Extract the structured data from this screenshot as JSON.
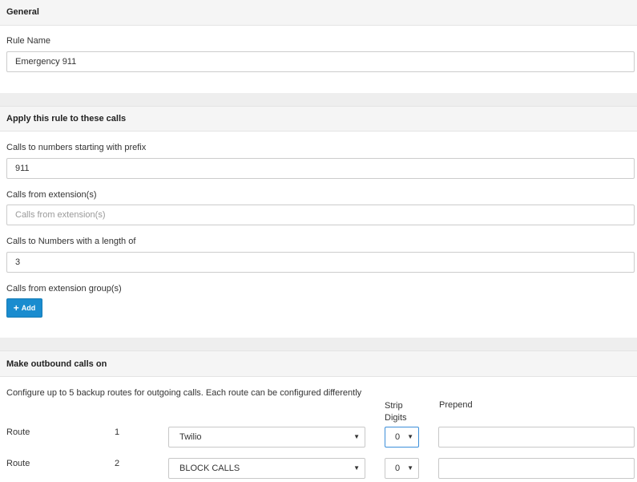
{
  "general": {
    "header": "General",
    "rule_name_label": "Rule Name",
    "rule_name_value": "Emergency 911"
  },
  "apply": {
    "header": "Apply this rule to these calls",
    "prefix_label": "Calls to numbers starting with prefix",
    "prefix_value": "911",
    "extensions_label": "Calls from extension(s)",
    "extensions_placeholder": "Calls from extension(s)",
    "length_label": "Calls to Numbers with a length of",
    "length_value": "3",
    "groups_label": "Calls from extension group(s)",
    "add_label": "Add"
  },
  "outbound": {
    "header": "Make outbound calls on",
    "description": "Configure up to 5 backup routes for outgoing calls. Each route can be configured differently",
    "col_strip": "Strip Digits",
    "col_prepend": "Prepend",
    "routes": [
      {
        "label": "Route",
        "number": "1",
        "provider": "Twilio",
        "strip": "0",
        "prepend": ""
      },
      {
        "label": "Route",
        "number": "2",
        "provider": "BLOCK CALLS",
        "strip": "0",
        "prepend": ""
      }
    ]
  },
  "icons": {
    "dropdown_arrow": "▼",
    "plus": "+"
  },
  "colors": {
    "accent": "#1a8ccf",
    "header_bg": "#f5f5f5"
  }
}
